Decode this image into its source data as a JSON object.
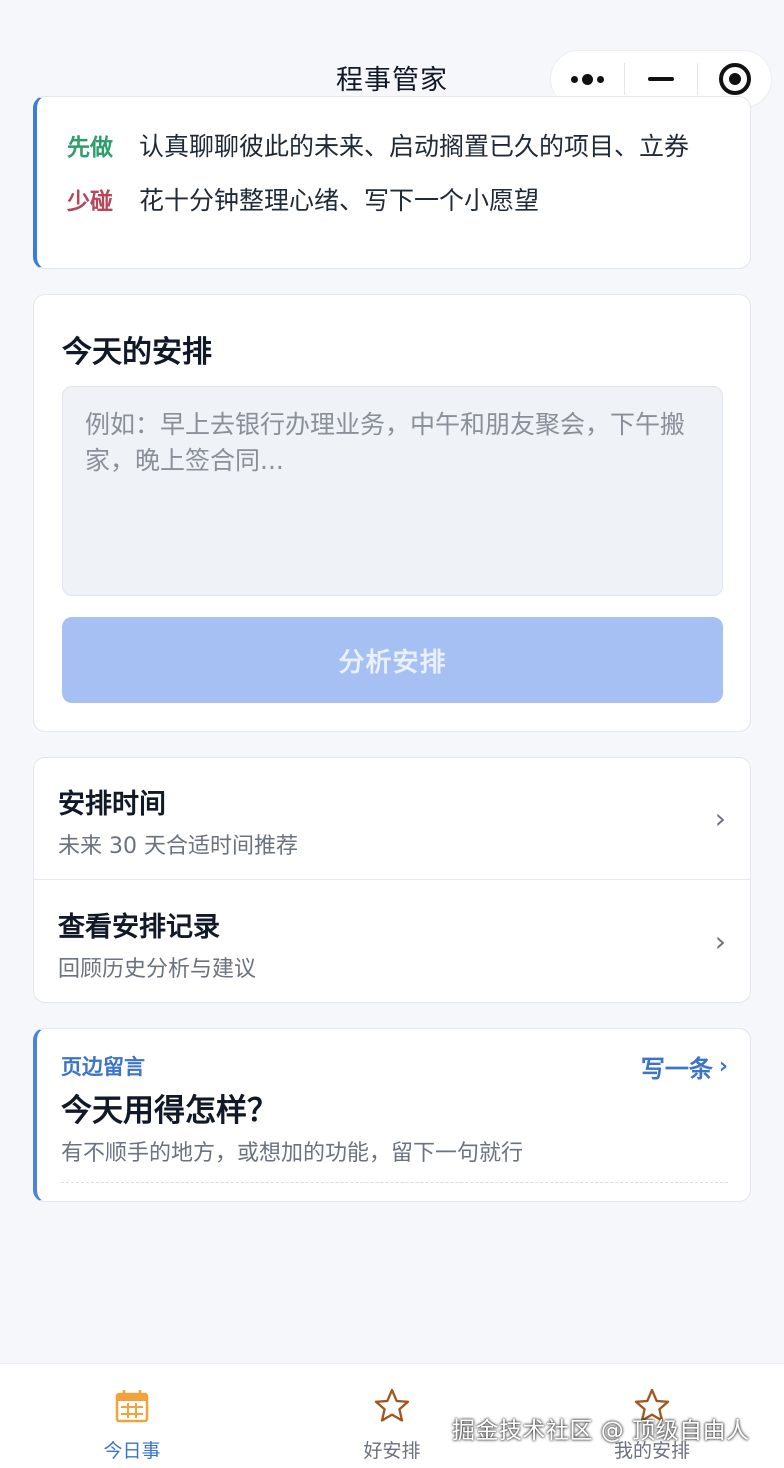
{
  "nav": {
    "title": "程事管家"
  },
  "tips": {
    "do_tag": "先做",
    "do_text": "认真聊聊彼此的未来、启动搁置已久的项目、立券",
    "avoid_tag": "少碰",
    "avoid_text": "花十分钟整理心绪、写下一个小愿望"
  },
  "plan": {
    "title": "今天的安排",
    "placeholder": "例如：早上去银行办理业务，中午和朋友聚会，下午搬家，晚上签合同...",
    "button_label": "分析安排"
  },
  "menu": {
    "items": [
      {
        "title": "安排时间",
        "subtitle": "未来 30 天合适时间推荐"
      },
      {
        "title": "查看安排记录",
        "subtitle": "回顾历史分析与建议"
      }
    ]
  },
  "feedback": {
    "eyebrow": "页边留言",
    "write_label": "写一条",
    "title": "今天用得怎样？",
    "subtitle": "有不顺手的地方，或想加的功能，留下一句就行"
  },
  "tabs": [
    {
      "label": "今日事",
      "icon": "calendar-icon",
      "active": true
    },
    {
      "label": "好安排",
      "icon": "star-icon",
      "active": false
    },
    {
      "label": "我的安排",
      "icon": "star-icon",
      "active": false
    }
  ],
  "watermark": "掘金技术社区 @ 顶级自由人",
  "colors": {
    "accent": "#3b74c9",
    "do_tag": "#2f9e6e",
    "avoid_tag": "#b5475a",
    "button_disabled": "#a6c0f4",
    "calendar_icon": "#f2a33a",
    "star_icon": "#a0561e"
  }
}
